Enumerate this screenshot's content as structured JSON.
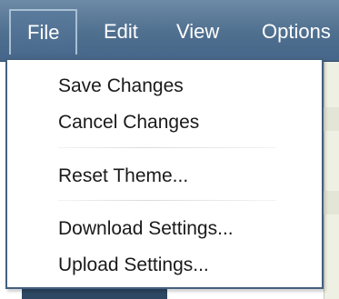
{
  "menubar": {
    "items": [
      {
        "label": "File",
        "active": true
      },
      {
        "label": "Edit",
        "active": false
      },
      {
        "label": "View",
        "active": false
      },
      {
        "label": "Options",
        "active": false
      }
    ]
  },
  "file_menu": {
    "items": [
      {
        "label": "Save Changes"
      },
      {
        "label": "Cancel Changes"
      },
      {
        "label": "Reset Theme..."
      },
      {
        "label": "Download Settings..."
      },
      {
        "label": "Upload Settings..."
      }
    ]
  },
  "colors": {
    "menubar_bg": "#4f6f8f",
    "menu_border": "#44607f",
    "text": "#1a1a1a"
  }
}
